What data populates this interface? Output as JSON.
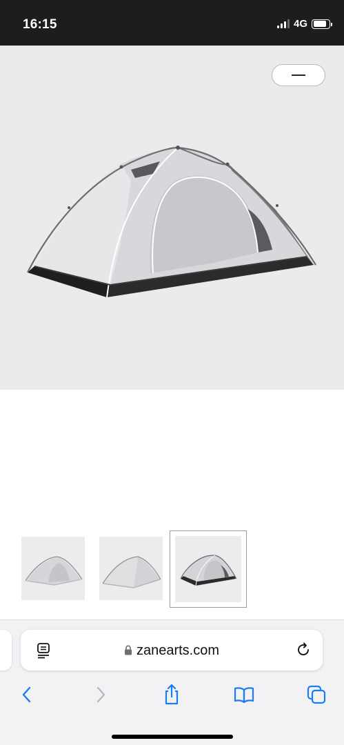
{
  "status_bar": {
    "time": "16:15",
    "network": "4G",
    "signal_bars_active": 3,
    "signal_bars_total": 4,
    "battery_level": 0.85
  },
  "product_gallery": {
    "main_image": "dome-tent-gray-front-three-quarter",
    "collapse_button_icon": "minus-icon",
    "thumbnails": [
      {
        "image": "dome-tent-gray-view-1",
        "selected": false
      },
      {
        "image": "dome-tent-gray-view-2",
        "selected": false
      },
      {
        "image": "dome-tent-gray-view-3",
        "selected": true
      }
    ]
  },
  "browser": {
    "url": "zanearts.com",
    "secure": true,
    "icons": {
      "reader": "reader-mode-icon",
      "lock": "lock-icon",
      "reload": "reload-icon",
      "back": "chevron-left-icon",
      "forward": "chevron-right-icon",
      "share": "share-icon",
      "bookmarks": "book-icon",
      "tabs": "tabs-icon"
    },
    "accent_color": "#1a7cf0",
    "disabled_color": "#b9b9bd"
  }
}
